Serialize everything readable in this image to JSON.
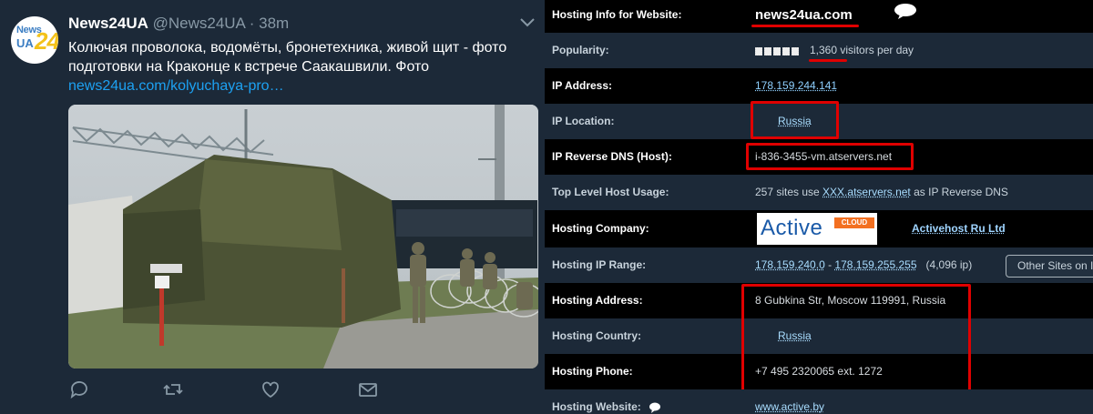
{
  "tweet": {
    "display_name": "News24UA",
    "handle": "@News24UA",
    "separator": "·",
    "time": "38m",
    "text": "Колючая проволока, водомёты, бронетехника, живой щит - фото подготовки на Краконце к встрече Саакашвили. Фото",
    "link": "news24ua.com/kolyuchaya-pro…",
    "avatar": {
      "logo_top": "News",
      "logo_ua": "UA",
      "logo_24": "24"
    },
    "actions": [
      "reply-icon",
      "retweet-icon",
      "like-icon",
      "message-icon"
    ],
    "colors": {
      "background": "#1c2938",
      "link": "#1da1f2",
      "muted": "#8899a6"
    }
  },
  "hosting": {
    "rows": [
      {
        "label": "Hosting Info for Website:",
        "value": "news24ua.com"
      },
      {
        "label": "Popularity:",
        "value": "1,360 visitors per day"
      },
      {
        "label": "IP Address:",
        "value": "178.159.244.141"
      },
      {
        "label": "IP Location:",
        "value": "Russia"
      },
      {
        "label": "IP Reverse DNS (Host):",
        "value": "i-836-3455-vm.atservers.net"
      },
      {
        "label": "Top Level Host Usage:",
        "value_prefix": "257 sites use ",
        "value_link": "XXX.atservers.net",
        "value_suffix": " as IP Reverse DNS"
      },
      {
        "label": "Hosting Company:",
        "value": "Activehost Ru Ltd",
        "logo_word": "Active",
        "logo_sub": "CLOUD"
      },
      {
        "label": "Hosting IP Range:",
        "range_start": "178.159.240.0",
        "range_sep": " - ",
        "range_end": "178.159.255.255",
        "range_count": "(4,096 ip)",
        "button": "Other Sites on I"
      },
      {
        "label": "Hosting Address:",
        "value": "8 Gubkina Str, Moscow 119991, Russia"
      },
      {
        "label": "Hosting Country:",
        "value": "Russia"
      },
      {
        "label": "Hosting Phone:",
        "value": "+7 495 2320065 ext. 1272"
      },
      {
        "label": "Hosting Website:",
        "value": "www.active.by"
      }
    ],
    "colors": {
      "highlight": "#e00000",
      "dark_row": "#000000",
      "blue_row": "#1c2938",
      "link": "#8fd0ff"
    }
  }
}
